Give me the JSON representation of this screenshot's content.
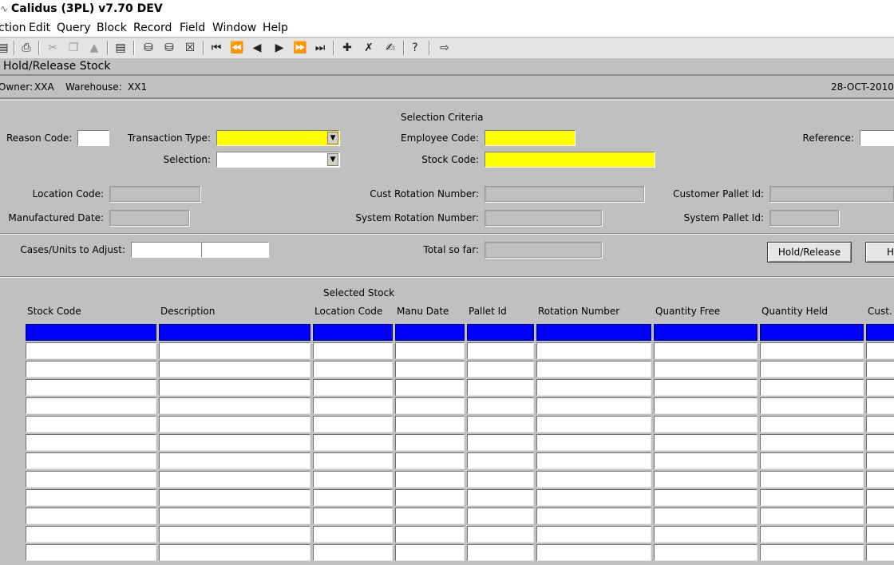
{
  "window": {
    "title": "Calidus (3PL) v7.70 DEV"
  },
  "menu": [
    "ction",
    "Edit",
    "Query",
    "Block",
    "Record",
    "Field",
    "Window",
    "Help"
  ],
  "toolbar": {
    "icons": [
      "save-icon",
      "print-icon",
      "cut-icon",
      "copy-icon",
      "paste-icon",
      "list-icon",
      "query-enter-icon",
      "query-execute-icon",
      "query-cancel-icon",
      "first-record-icon",
      "previous-block-icon",
      "previous-record-icon",
      "next-record-icon",
      "next-block-icon",
      "last-record-icon",
      "insert-record-icon",
      "delete-record-icon",
      "clear-record-icon",
      "help-icon",
      "exit-icon"
    ]
  },
  "form": {
    "title": "Hold/Release Stock",
    "owner_label": "Owner:",
    "owner_value": "XXA",
    "warehouse_label": "Warehouse:",
    "warehouse_value": "XX1",
    "date": "28-OCT-2010"
  },
  "criteria": {
    "heading": "Selection Criteria",
    "reason_code_label": "Reason Code:",
    "reason_code_value": "",
    "transaction_type_label": "Transaction Type:",
    "transaction_type_value": "",
    "selection_label": "Selection:",
    "selection_value": "",
    "employee_code_label": "Employee Code:",
    "employee_code_value": "",
    "stock_code_label": "Stock Code:",
    "stock_code_value": "",
    "reference_label": "Reference:",
    "reference_value": "",
    "location_code_label": "Location Code:",
    "manufactured_date_label": "Manufactured Date:",
    "cust_rotation_label": "Cust Rotation Number:",
    "system_rotation_label": "System Rotation Number:",
    "customer_pallet_label": "Customer Pallet Id:",
    "system_pallet_label": "System Pallet Id:",
    "cases_units_label": "Cases/Units to Adjust:",
    "total_so_far_label": "Total so far:",
    "hold_release_button": "Hold/Release",
    "second_button": "H"
  },
  "selected_stock": {
    "heading": "Selected Stock",
    "columns": [
      "Stock Code",
      "Description",
      "Location Code",
      "Manu Date",
      "Pallet Id",
      "Rotation Number",
      "Quantity Free",
      "Quantity Held",
      "Cust."
    ],
    "row_count": 13,
    "selected_row_color": "#0000ff"
  },
  "colors": {
    "required_field": "#ffff00",
    "background": "#c0c0c0"
  }
}
